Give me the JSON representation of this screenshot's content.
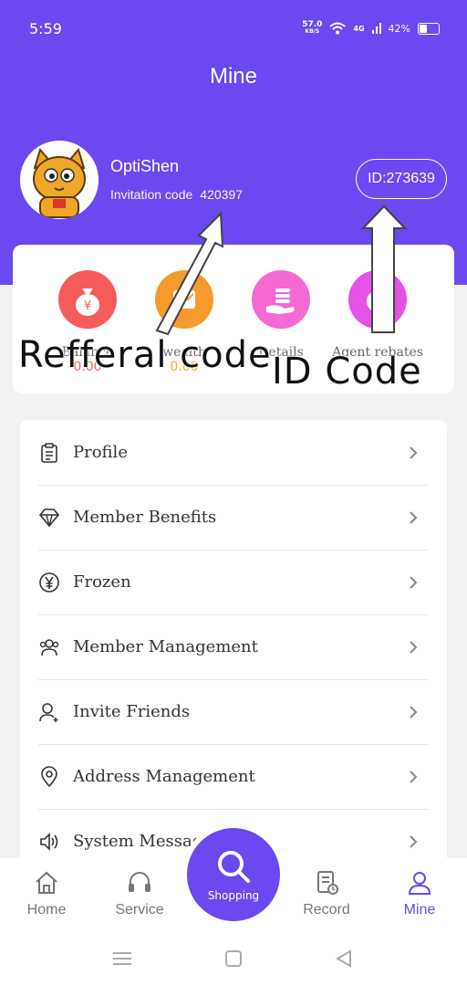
{
  "status_bar": {
    "time": "5:59",
    "net_speed": "57.0",
    "net_unit": "KB/S",
    "signal": "4G",
    "battery": "42%"
  },
  "page": {
    "title": "Mine"
  },
  "user": {
    "name": "OptiShen",
    "invitation_label": "Invitation code",
    "invitation_code": "420397",
    "id_text": "ID:273639"
  },
  "stats": [
    {
      "label": "Balance",
      "value": "0.00",
      "color": "#f25c63"
    },
    {
      "label": "wealth",
      "value": "0.00",
      "color": "#f59a2c"
    },
    {
      "label": "Details",
      "value": "",
      "color": "#f45fd0"
    },
    {
      "label": "Agent rebates",
      "value": "",
      "color": "#e552e6"
    }
  ],
  "annotations": {
    "referral": "Refferal code",
    "id": "ID Code"
  },
  "menu": [
    {
      "label": "Profile",
      "icon": "clipboard-icon"
    },
    {
      "label": "Member Benefits",
      "icon": "diamond-icon"
    },
    {
      "label": "Frozen",
      "icon": "yuan-icon"
    },
    {
      "label": "Member Management",
      "icon": "users-icon"
    },
    {
      "label": "Invite Friends",
      "icon": "user-plus-icon"
    },
    {
      "label": "Address Management",
      "icon": "location-icon"
    },
    {
      "label": "System Messag",
      "icon": "speaker-icon"
    }
  ],
  "nav": {
    "home": "Home",
    "service": "Service",
    "shopping": "Shopping",
    "record": "Record",
    "mine": "Mine"
  },
  "colors": {
    "accent": "#6b48f0"
  }
}
